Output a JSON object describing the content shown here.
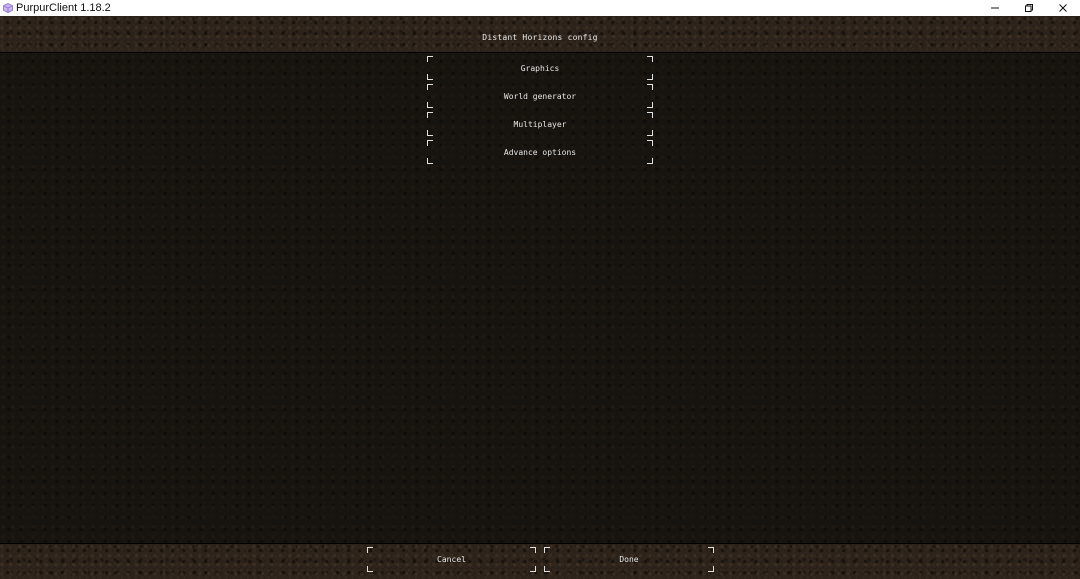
{
  "window": {
    "title": "PurpurClient 1.18.2",
    "icon": "purpur-cube-icon",
    "controls": [
      "minimize-icon",
      "restore-icon",
      "close-icon"
    ]
  },
  "screen": {
    "title": "Distant Horizons config"
  },
  "menu": {
    "graphics_label": "Graphics",
    "world_generator_label": "World generator",
    "multiplayer_label": "Multiplayer",
    "advanced_label": "Advance options"
  },
  "footer": {
    "cancel_label": "Cancel",
    "done_label": "Done"
  },
  "colors": {
    "accent_icon": "#a98be0",
    "text": "#e6e6e6",
    "background": "#17130e"
  }
}
